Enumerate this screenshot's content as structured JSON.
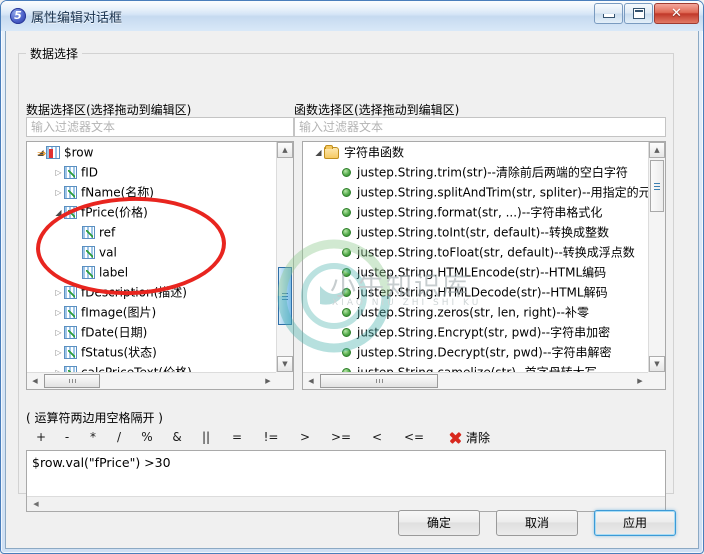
{
  "window": {
    "title": "属性编辑对话框",
    "icon": "app-logo-icon",
    "controls": {
      "minimize": "minimize-icon",
      "maximize": "maximize-icon",
      "close": "✕"
    }
  },
  "groupbox": {
    "title": "数据选择"
  },
  "left_panel": {
    "header": "数据选择区(选择拖动到编辑区)",
    "filter_placeholder": "输入过滤器文本",
    "filter_value": "",
    "tree": [
      {
        "label": "$row",
        "indent": 0,
        "expander": "open",
        "icon": "row-icon"
      },
      {
        "label": "fID",
        "indent": 1,
        "expander": "closed",
        "icon": "column-icon"
      },
      {
        "label": "fName(名称)",
        "indent": 1,
        "expander": "closed",
        "icon": "column-icon"
      },
      {
        "label": "fPrice(价格)",
        "indent": 1,
        "expander": "open",
        "icon": "column-icon"
      },
      {
        "label": "ref",
        "indent": 2,
        "expander": "blank",
        "icon": "column-icon"
      },
      {
        "label": "val",
        "indent": 2,
        "expander": "blank",
        "icon": "column-icon"
      },
      {
        "label": "label",
        "indent": 2,
        "expander": "blank",
        "icon": "column-icon"
      },
      {
        "label": "fDescription(描述)",
        "indent": 1,
        "expander": "closed",
        "icon": "column-icon"
      },
      {
        "label": "fImage(图片)",
        "indent": 1,
        "expander": "closed",
        "icon": "column-icon"
      },
      {
        "label": "fDate(日期)",
        "indent": 1,
        "expander": "closed",
        "icon": "column-icon"
      },
      {
        "label": "fStatus(状态)",
        "indent": 1,
        "expander": "closed",
        "icon": "column-icon"
      },
      {
        "label": "calcPriceText(价格)",
        "indent": 1,
        "expander": "closed",
        "icon": "column-icon"
      }
    ]
  },
  "right_panel": {
    "header": "函数选择区(选择拖动到编辑区)",
    "filter_placeholder": "输入过滤器文本",
    "filter_value": "",
    "tree": [
      {
        "label": "字符串函数",
        "indent": 0,
        "expander": "open",
        "icon": "folder-icon"
      },
      {
        "label": "justep.String.trim(str)--清除前后两端的空白字符",
        "indent": 1,
        "expander": "blank",
        "icon": "function-dot-icon"
      },
      {
        "label": "justep.String.splitAndTrim(str, spliter)--用指定的元素分",
        "indent": 1,
        "expander": "blank",
        "icon": "function-dot-icon"
      },
      {
        "label": "justep.String.format(str, ...)--字符串格式化",
        "indent": 1,
        "expander": "blank",
        "icon": "function-dot-icon"
      },
      {
        "label": "justep.String.toInt(str, default)--转换成整数",
        "indent": 1,
        "expander": "blank",
        "icon": "function-dot-icon"
      },
      {
        "label": "justep.String.toFloat(str, default)--转换成浮点数",
        "indent": 1,
        "expander": "blank",
        "icon": "function-dot-icon"
      },
      {
        "label": "justep.String.HTMLEncode(str)--HTML编码",
        "indent": 1,
        "expander": "blank",
        "icon": "function-dot-icon"
      },
      {
        "label": "justep.String.HTMLDecode(str)--HTML解码",
        "indent": 1,
        "expander": "blank",
        "icon": "function-dot-icon"
      },
      {
        "label": "justep.String.zeros(str, len, right)--补零",
        "indent": 1,
        "expander": "blank",
        "icon": "function-dot-icon"
      },
      {
        "label": "justep.String.Encrypt(str, pwd)--字符串加密",
        "indent": 1,
        "expander": "blank",
        "icon": "function-dot-icon"
      },
      {
        "label": "justep.String.Decrypt(str, pwd)--字符串解密",
        "indent": 1,
        "expander": "blank",
        "icon": "function-dot-icon"
      },
      {
        "label": "justep.String.camelize(str)--首字母转大写",
        "indent": 1,
        "expander": "blank",
        "icon": "function-dot-icon"
      }
    ]
  },
  "operators": {
    "hint": "( 运算符两边用空格隔开 )",
    "items": [
      "+",
      "-",
      "*",
      "/",
      "%",
      "&",
      "||",
      "=",
      "!=",
      ">",
      ">=",
      "<",
      "<="
    ],
    "clear_label": "清除",
    "clear_icon": "red-x-icon"
  },
  "expression": {
    "value": "$row.val(\"fPrice\") >30"
  },
  "footer": {
    "ok_label": "确定",
    "cancel_label": "取消",
    "apply_label": "应用"
  },
  "watermark": {
    "text": "小牛知识库",
    "subtext": "XIAO NIU ZHI SHI KU"
  },
  "colors": {
    "accent": "#3c9ad6",
    "annotation": "#e8251f",
    "close": "#c1392a"
  }
}
